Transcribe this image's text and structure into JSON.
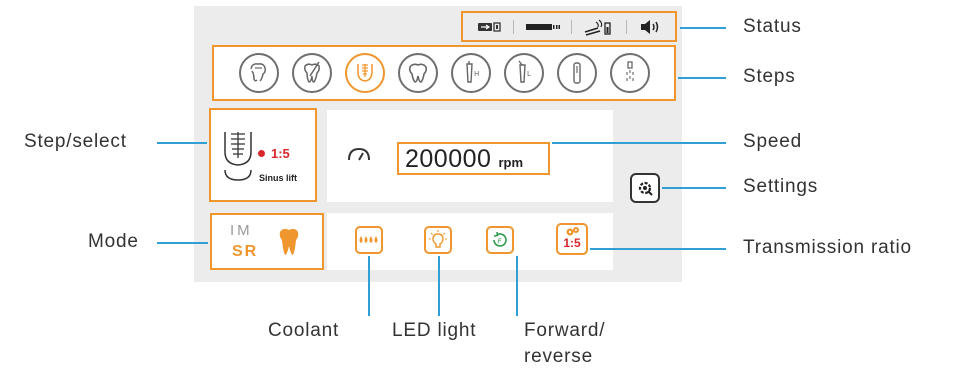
{
  "status_bar": {
    "icons": [
      "usb-battery-icon",
      "battery-level-icon",
      "handpiece-signal-icon",
      "volume-icon"
    ]
  },
  "steps": {
    "icons": [
      "crown-prep-icon",
      "root-canal-icon",
      "implant-sinus-icon",
      "tooth-icon",
      "handpiece-h-icon",
      "handpiece-l-icon",
      "file-icon",
      "irrigation-icon"
    ],
    "active_index": 2
  },
  "step_select": {
    "ratio": "1:5",
    "name": "Sinus lift"
  },
  "speed": {
    "value": "200000",
    "unit": "rpm"
  },
  "mode": {
    "top": "IM",
    "bottom": "SR"
  },
  "functions": {
    "ratio": "1:5",
    "icons": [
      "coolant-icon",
      "led-light-icon",
      "forward-reverse-icon",
      "transmission-ratio-icon"
    ]
  },
  "callouts": {
    "status": "Status",
    "steps": "Steps",
    "step_select": "Step/select",
    "speed": "Speed",
    "settings": "Settings",
    "mode": "Mode",
    "transmission_ratio": "Transmission ratio",
    "coolant": "Coolant",
    "led_light": "LED light",
    "forward_reverse_line1": "Forward/",
    "forward_reverse_line2": "reverse"
  },
  "colors": {
    "accent": "#f0962e",
    "red": "#d9262a",
    "leader_line": "#2f9fd6",
    "panel_bg": "#ececec"
  }
}
